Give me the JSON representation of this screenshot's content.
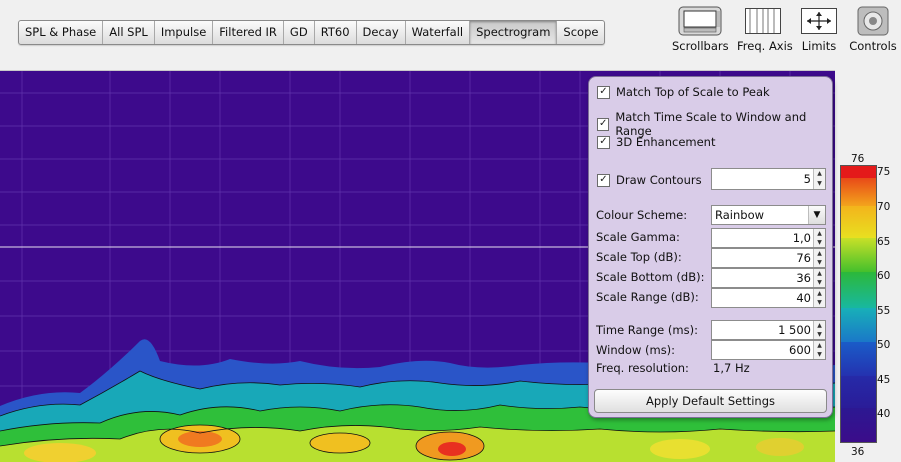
{
  "tabs": [
    "SPL & Phase",
    "All SPL",
    "Impulse",
    "Filtered IR",
    "GD",
    "RT60",
    "Decay",
    "Waterfall",
    "Spectrogram",
    "Scope"
  ],
  "active_tab": "Spectrogram",
  "toolbar": {
    "scrollbars": "Scrollbars",
    "freq_axis": "Freq. Axis",
    "limits": "Limits",
    "controls": "Controls"
  },
  "controls": {
    "match_top": "Match Top of Scale to Peak",
    "match_time": "Match Time Scale to Window and Range",
    "enhancement_3d": "3D Enhancement",
    "draw_contours": "Draw Contours",
    "contours_value": "5",
    "colour_scheme_label": "Colour Scheme:",
    "colour_scheme_value": "Rainbow",
    "scale_gamma_label": "Scale Gamma:",
    "scale_gamma_value": "1,0",
    "scale_top_label": "Scale Top (dB):",
    "scale_top_value": "76",
    "scale_bottom_label": "Scale Bottom (dB):",
    "scale_bottom_value": "36",
    "scale_range_label": "Scale Range (dB):",
    "scale_range_value": "40",
    "time_range_label": "Time Range (ms):",
    "time_range_value": "1 500",
    "window_label": "Window (ms):",
    "window_value": "600",
    "freq_res_label": "Freq. resolution:",
    "freq_res_value": "1,7 Hz",
    "apply_default": "Apply Default Settings"
  },
  "color_scale": {
    "top_label": "76",
    "bottom_label": "36",
    "ticks": [
      "75",
      "70",
      "65",
      "60",
      "55",
      "50",
      "45",
      "40"
    ]
  },
  "colors": {
    "background": "#3d0a8c",
    "panel": "#d9cce8"
  }
}
